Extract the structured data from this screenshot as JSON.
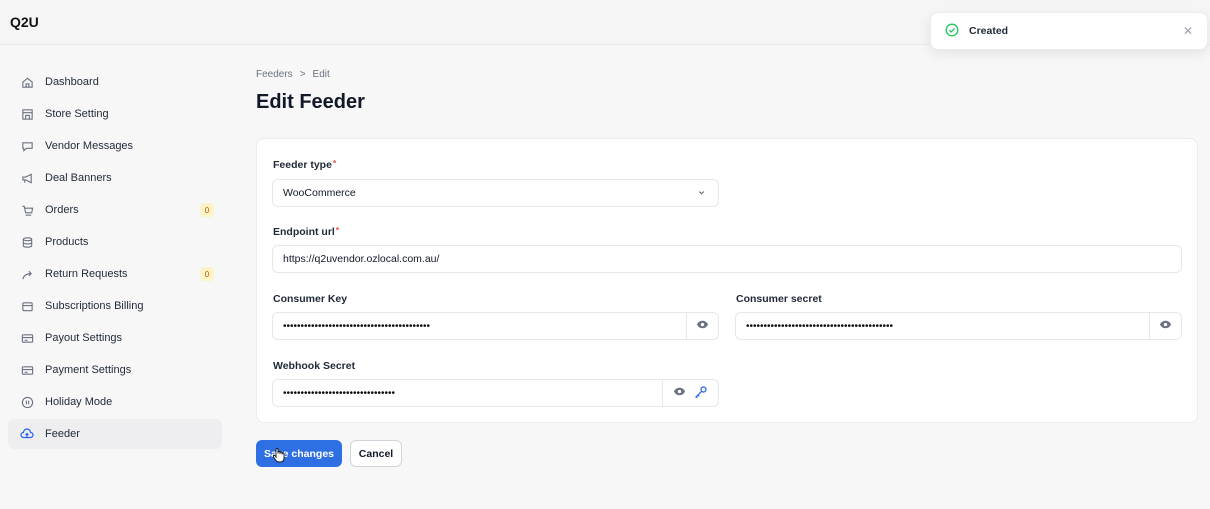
{
  "app": {
    "brand": "Q2U"
  },
  "sidebar": {
    "items": [
      {
        "label": "Dashboard",
        "icon": "home-icon"
      },
      {
        "label": "Store Setting",
        "icon": "store-icon"
      },
      {
        "label": "Vendor Messages",
        "icon": "message-icon"
      },
      {
        "label": "Deal Banners",
        "icon": "megaphone-icon"
      },
      {
        "label": "Orders",
        "icon": "cart-icon",
        "badge": "0"
      },
      {
        "label": "Products",
        "icon": "database-icon"
      },
      {
        "label": "Return Requests",
        "icon": "return-arrow-icon",
        "badge": "0"
      },
      {
        "label": "Subscriptions Billing",
        "icon": "wallet-icon"
      },
      {
        "label": "Payout Settings",
        "icon": "card-icon"
      },
      {
        "label": "Payment Settings",
        "icon": "card-icon"
      },
      {
        "label": "Holiday Mode",
        "icon": "pause-icon"
      },
      {
        "label": "Feeder",
        "icon": "upload-cloud-icon",
        "active": true
      }
    ]
  },
  "breadcrumb": {
    "root": "Feeders",
    "separator": ">",
    "current": "Edit"
  },
  "page": {
    "title": "Edit Feeder"
  },
  "form": {
    "feeder_type": {
      "label": "Feeder type",
      "required": "*",
      "value": "WooCommerce"
    },
    "endpoint_url": {
      "label": "Endpoint url",
      "required": "*",
      "value": "https://q2uvendor.ozlocal.com.au/"
    },
    "consumer_key": {
      "label": "Consumer Key",
      "value": "••••••••••••••••••••••••••••••••••••••••••"
    },
    "consumer_secret": {
      "label": "Consumer secret",
      "value": "••••••••••••••••••••••••••••••••••••••••••"
    },
    "webhook_secret": {
      "label": "Webhook Secret",
      "value": "••••••••••••••••••••••••••••••••"
    }
  },
  "actions": {
    "save_label": "Save changes",
    "cancel_label": "Cancel"
  },
  "toast": {
    "message": "Created",
    "icon": "check-circle-icon"
  },
  "colors": {
    "primary": "#2f6fe4",
    "success": "#22c55e",
    "badge_bg": "#fef3c7",
    "badge_text": "#b45309"
  }
}
